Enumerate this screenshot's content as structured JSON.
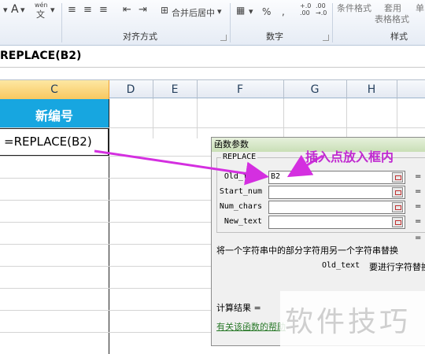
{
  "ribbon": {
    "font_a": "A",
    "wen": "wén",
    "wen_char": "文",
    "merge_center": "合并后居中",
    "percent": "%",
    "comma": ",",
    "dec_inc": "+.0\n.00",
    "dec_dec": ".00\n→.0",
    "conditional_format": "条件格式",
    "table_format_1": "套用",
    "table_format_2": "表格格式",
    "cell_single": "单",
    "group_alignment": "对齐方式",
    "group_number": "数字",
    "group_styles": "样式"
  },
  "formula_bar": {
    "text": "REPLACE(B2)"
  },
  "columns": [
    "C",
    "D",
    "E",
    "F",
    "G",
    "H"
  ],
  "cells": {
    "header": "新编号",
    "formula": "=REPLACE(B2)"
  },
  "dialog": {
    "title": "函数参数",
    "function_name": "REPLACE",
    "args": [
      {
        "label": "Old_text",
        "value": "B2"
      },
      {
        "label": "Start_num",
        "value": ""
      },
      {
        "label": "Num_chars",
        "value": ""
      },
      {
        "label": "New_text",
        "value": ""
      }
    ],
    "eq": "=",
    "description": "将一个字符串中的部分字符用另一个字符串替换",
    "arg_help_name": "Old_text",
    "arg_help_text": "要进行字符替换的",
    "result_label": "计算结果 =",
    "help_link": "有关该函数的帮助"
  },
  "annotation": "插入点放入框内",
  "watermark": "软件技巧",
  "colors": {
    "header_cell_bg": "#17a6e0",
    "annotation": "#c02ad0",
    "arrow": "#d42fe0",
    "selected_col": "#f8c860"
  }
}
